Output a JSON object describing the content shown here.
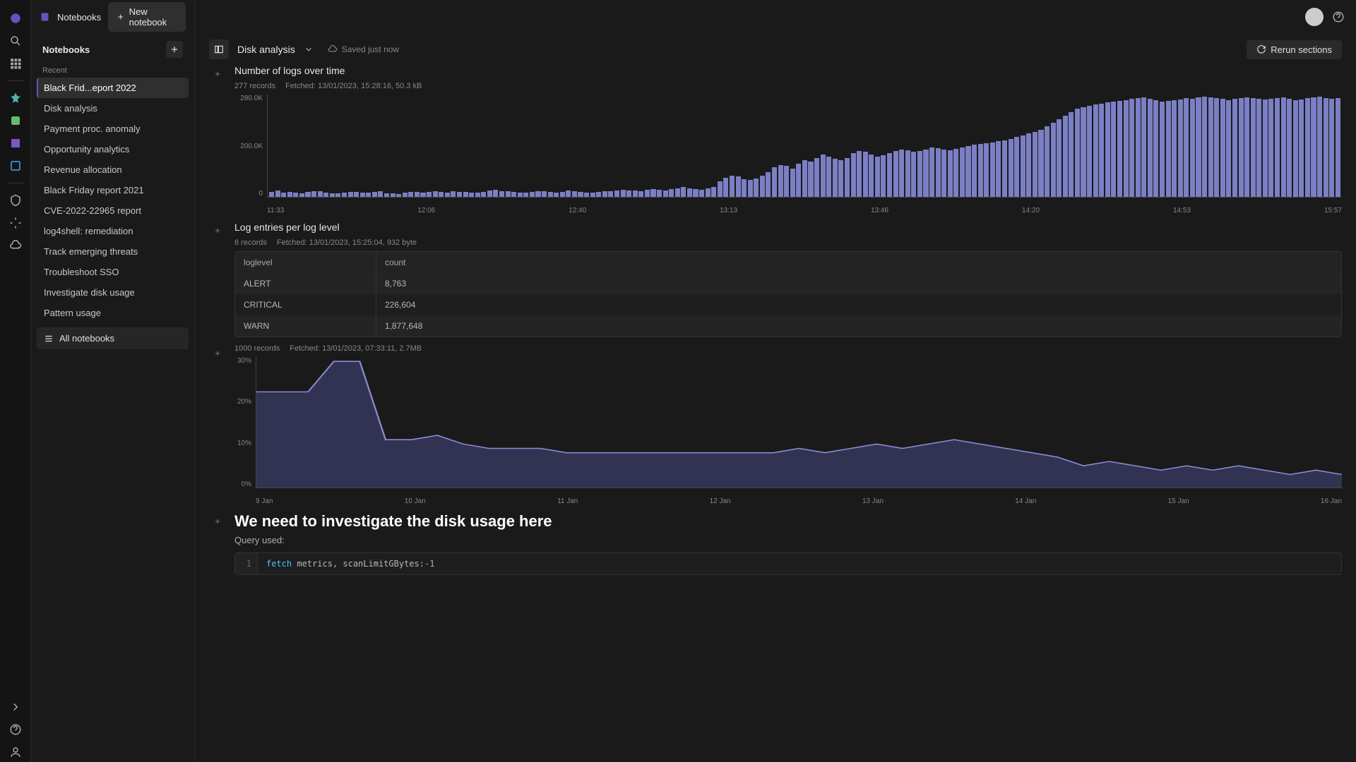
{
  "rail": {
    "expand": "expand",
    "help": "help",
    "user": "user"
  },
  "sidebar": {
    "app_title": "Notebooks",
    "new_btn": "New notebook",
    "header": "Notebooks",
    "recent_label": "Recent",
    "items": [
      "Black Frid...eport 2022",
      "Disk analysis",
      "Payment proc. anomaly",
      "Opportunity analytics",
      "Revenue allocation",
      "Black Friday report 2021",
      "CVE-2022-22965 report",
      "log4shell: remediation",
      "Track emerging threats",
      "Troubleshoot SSO",
      "Investigate disk usage",
      "Pattern usage"
    ],
    "all_label": "All notebooks"
  },
  "page": {
    "title": "Disk analysis",
    "saved": "Saved just now",
    "rerun": "Rerun sections"
  },
  "section1": {
    "title": "Number of logs over time",
    "records": "277 records",
    "fetched": "Fetched: 13/01/2023, 15:28:16, 50.3 kB"
  },
  "section2": {
    "title": "Log entries per log level",
    "records": "6 records",
    "fetched": "Fetched: 13/01/2023, 15:25:04, 932 byte",
    "col1": "loglevel",
    "col2": "count",
    "rows": [
      {
        "level": "ALERT",
        "count": "8,763"
      },
      {
        "level": "CRITICAL",
        "count": "226,604"
      },
      {
        "level": "WARN",
        "count": "1,877,648"
      }
    ]
  },
  "section3": {
    "records": "1000 records",
    "fetched": "Fetched: 13/01/2023, 07:33:11, 2.7MB"
  },
  "section4": {
    "title": "We need to investigate the disk usage here",
    "sub": "Query used:",
    "line1": "1",
    "code_kw": "fetch",
    "code_rest": " metrics, scanLimitGBytes:",
    "code_num": "-1"
  },
  "chart_data": [
    {
      "type": "bar",
      "title": "Number of logs over time",
      "ylabel": "",
      "ylim": [
        0,
        290000
      ],
      "y_ticks": [
        "280.0K",
        "200.0K",
        "0"
      ],
      "x_ticks": [
        "11:33",
        "12:06",
        "12:40",
        "13:13",
        "13:46",
        "14:20",
        "14:53",
        "15:57"
      ],
      "categories_note": "time buckets 11:33 to 15:57",
      "values": [
        15000,
        18000,
        13000,
        14000,
        12000,
        11000,
        15000,
        17000,
        16000,
        12000,
        11000,
        10000,
        12000,
        14000,
        15000,
        13000,
        12000,
        14000,
        16000,
        11000,
        10000,
        9000,
        12000,
        15000,
        14000,
        13000,
        15000,
        17000,
        14000,
        12000,
        16000,
        15000,
        14000,
        13000,
        12000,
        15000,
        18000,
        20000,
        17000,
        16000,
        14000,
        13000,
        12000,
        15000,
        17000,
        16000,
        14000,
        13000,
        15000,
        18000,
        16000,
        14000,
        13000,
        12000,
        15000,
        17000,
        16000,
        18000,
        20000,
        19000,
        18000,
        17000,
        20000,
        22000,
        21000,
        19000,
        22000,
        25000,
        28000,
        24000,
        22000,
        20000,
        24000,
        28000,
        45000,
        55000,
        60000,
        58000,
        50000,
        48000,
        52000,
        60000,
        70000,
        85000,
        90000,
        88000,
        80000,
        95000,
        105000,
        100000,
        110000,
        120000,
        115000,
        108000,
        105000,
        110000,
        125000,
        130000,
        128000,
        120000,
        115000,
        118000,
        125000,
        130000,
        135000,
        132000,
        128000,
        130000,
        135000,
        140000,
        138000,
        135000,
        132000,
        136000,
        140000,
        145000,
        148000,
        150000,
        152000,
        155000,
        158000,
        160000,
        165000,
        170000,
        175000,
        180000,
        185000,
        190000,
        200000,
        210000,
        220000,
        230000,
        240000,
        250000,
        255000,
        258000,
        262000,
        265000,
        268000,
        270000,
        272000,
        275000,
        278000,
        280000,
        282000,
        278000,
        275000,
        270000,
        272000,
        275000,
        277000,
        280000,
        278000,
        282000,
        285000,
        283000,
        280000,
        278000,
        275000,
        278000,
        280000,
        282000,
        280000,
        278000,
        276000,
        278000,
        280000,
        282000,
        278000,
        275000,
        277000,
        280000,
        282000,
        284000,
        281000,
        278000,
        280000
      ]
    },
    {
      "type": "table",
      "title": "Log entries per log level",
      "columns": [
        "loglevel",
        "count"
      ],
      "rows": [
        [
          "ALERT",
          8763
        ],
        [
          "CRITICAL",
          226604
        ],
        [
          "WARN",
          1877648
        ]
      ]
    },
    {
      "type": "area",
      "title": "",
      "ylabel": "",
      "ylim": [
        0,
        30
      ],
      "y_ticks": [
        "30%",
        "20%",
        "10%",
        "0%"
      ],
      "x_ticks": [
        "9 Jan",
        "10 Jan",
        "11 Jan",
        "12 Jan",
        "13 Jan",
        "14 Jan",
        "15 Jan",
        "16 Jan"
      ],
      "x": [
        "9 Jan",
        "",
        "",
        "10 Jan",
        "",
        "",
        "11 Jan",
        "",
        "",
        "12 Jan",
        "",
        "",
        "13 Jan",
        "",
        "",
        "14 Jan",
        "",
        "",
        "15 Jan",
        "",
        "",
        "16 Jan"
      ],
      "values": [
        22,
        22,
        22,
        29,
        29,
        11,
        11,
        12,
        10,
        9,
        9,
        9,
        8,
        8,
        8,
        8,
        8,
        8,
        8,
        8,
        8,
        9,
        8,
        9,
        10,
        9,
        10,
        11,
        10,
        9,
        8,
        7,
        5,
        6,
        5,
        4,
        5,
        4,
        5,
        4,
        3,
        4,
        3
      ]
    }
  ]
}
